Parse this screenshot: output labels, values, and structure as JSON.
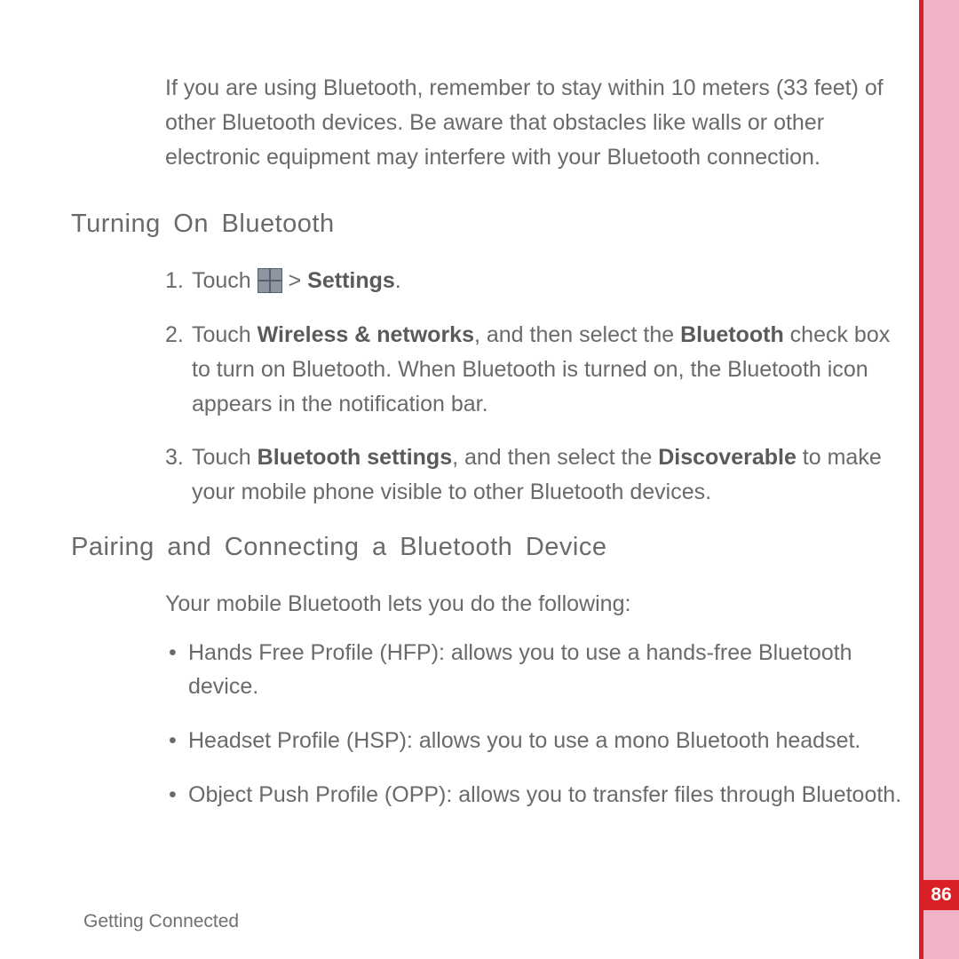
{
  "intro": "If you are using Bluetooth, remember to stay within 10 meters (33 feet) of other Bluetooth devices. Be aware that obstacles like walls or other electronic equipment may interfere with your Bluetooth connection.",
  "section1": {
    "heading": "Turning On Bluetooth"
  },
  "steps": {
    "n1": "1. ",
    "s1a": "Touch ",
    "s1b": " > ",
    "s1_settings": "Settings",
    "s1c": ".",
    "n2": "2. ",
    "s2a": "Touch ",
    "s2_wn": "Wireless & networks",
    "s2b": ", and then select the ",
    "s2_bt": "Bluetooth",
    "s2c": " check box to turn on Bluetooth. When Bluetooth is turned on, the Bluetooth icon appears in the notification bar.",
    "n3": "3. ",
    "s3a": "Touch ",
    "s3_bts": "Bluetooth settings",
    "s3b": ", and then select the ",
    "s3_disc": "Discoverable",
    "s3c": " to make your mobile phone visible to other Bluetooth devices."
  },
  "section2": {
    "heading": "Pairing and Connecting a Bluetooth Device",
    "lead": "Your mobile Bluetooth lets you do the following:"
  },
  "bullets": {
    "dot": "•",
    "b1": "Hands Free Profile (HFP): allows you to use a hands-free Bluetooth device.",
    "b2": "Headset Profile (HSP): allows you to use a mono Bluetooth headset.",
    "b3": "Object Push Profile (OPP): allows you to transfer files through Bluetooth."
  },
  "footer": "Getting Connected",
  "page_number": "86"
}
